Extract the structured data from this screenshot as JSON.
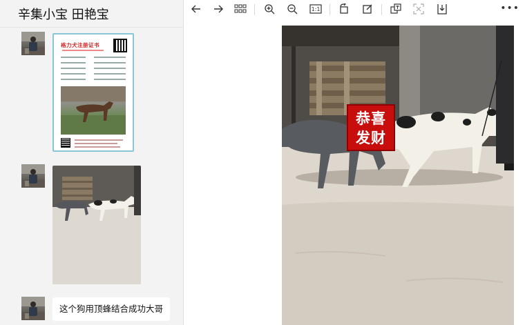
{
  "chat": {
    "title": "辛集小宝 田艳宝",
    "certificate": {
      "title": "格力犬注册证书"
    },
    "text_message": "这个狗用顶蜂结合成功大哥"
  },
  "photo_stamp": {
    "line1": "恭喜",
    "line2": "发财"
  },
  "toolbar": {
    "actual_size_label": "1:1",
    "more_label": "•••"
  },
  "icons": {
    "back": "arrow-left-icon",
    "forward": "arrow-right-icon",
    "grid": "grid-icon",
    "zoom_in": "zoom-in-icon",
    "zoom_out": "zoom-out-icon",
    "actual_size": "actual-size-icon",
    "rotate": "rotate-icon",
    "edit": "edit-icon",
    "translate": "translate-icon",
    "scan": "scan-icon",
    "download": "download-icon",
    "more": "more-icon"
  },
  "colors": {
    "stamp": "#c80d0d",
    "cert_border": "#88c7d6",
    "chat_bg": "#f3f3f3"
  }
}
